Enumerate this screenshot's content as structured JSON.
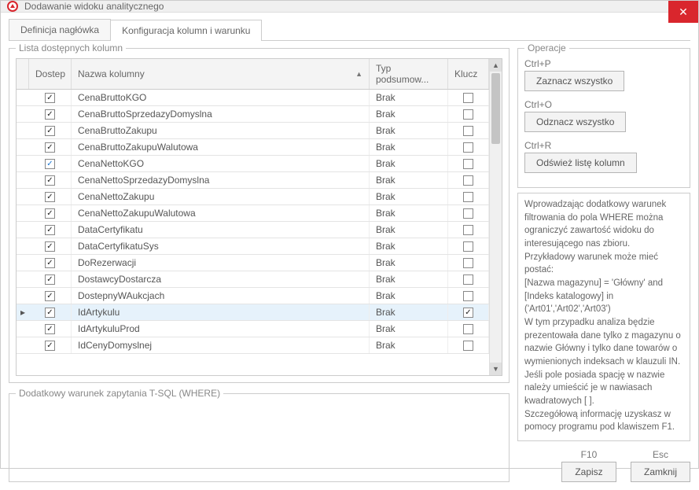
{
  "window": {
    "title": "Dodawanie widoku analitycznego"
  },
  "tabs": {
    "def": "Definicja nagłówka",
    "cfg": "Konfiguracja kolumn  i warunku"
  },
  "columns_fs": {
    "legend": "Lista dostępnych kolumn"
  },
  "headers": {
    "dostep": "Dostep",
    "nazwa": "Nazwa kolumny",
    "typ": "Typ podsumow...",
    "klucz": "Klucz"
  },
  "rows": [
    {
      "dostep": true,
      "blue": false,
      "nazwa": "CenaBruttoKGO",
      "typ": "Brak",
      "klucz": false,
      "sel": false
    },
    {
      "dostep": true,
      "blue": false,
      "nazwa": "CenaBruttoSprzedazyDomyslna",
      "typ": "Brak",
      "klucz": false,
      "sel": false
    },
    {
      "dostep": true,
      "blue": false,
      "nazwa": "CenaBruttoZakupu",
      "typ": "Brak",
      "klucz": false,
      "sel": false
    },
    {
      "dostep": true,
      "blue": false,
      "nazwa": "CenaBruttoZakupuWalutowa",
      "typ": "Brak",
      "klucz": false,
      "sel": false
    },
    {
      "dostep": true,
      "blue": true,
      "nazwa": "CenaNettoKGO",
      "typ": "Brak",
      "klucz": false,
      "sel": false
    },
    {
      "dostep": true,
      "blue": false,
      "nazwa": "CenaNettoSprzedazyDomyslna",
      "typ": "Brak",
      "klucz": false,
      "sel": false
    },
    {
      "dostep": true,
      "blue": false,
      "nazwa": "CenaNettoZakupu",
      "typ": "Brak",
      "klucz": false,
      "sel": false
    },
    {
      "dostep": true,
      "blue": false,
      "nazwa": "CenaNettoZakupuWalutowa",
      "typ": "Brak",
      "klucz": false,
      "sel": false
    },
    {
      "dostep": true,
      "blue": false,
      "nazwa": "DataCertyfikatu",
      "typ": "Brak",
      "klucz": false,
      "sel": false
    },
    {
      "dostep": true,
      "blue": false,
      "nazwa": "DataCertyfikatuSys",
      "typ": "Brak",
      "klucz": false,
      "sel": false
    },
    {
      "dostep": true,
      "blue": false,
      "nazwa": "DoRezerwacji",
      "typ": "Brak",
      "klucz": false,
      "sel": false
    },
    {
      "dostep": true,
      "blue": false,
      "nazwa": "DostawcyDostarcza",
      "typ": "Brak",
      "klucz": false,
      "sel": false
    },
    {
      "dostep": true,
      "blue": false,
      "nazwa": "DostepnyWAukcjach",
      "typ": "Brak",
      "klucz": false,
      "sel": false
    },
    {
      "dostep": true,
      "blue": false,
      "nazwa": "IdArtykulu",
      "typ": "Brak",
      "klucz": true,
      "sel": true
    },
    {
      "dostep": true,
      "blue": false,
      "nazwa": "IdArtykuluProd",
      "typ": "Brak",
      "klucz": false,
      "sel": false
    },
    {
      "dostep": true,
      "blue": false,
      "nazwa": "IdCenyDomyslnej",
      "typ": "Brak",
      "klucz": false,
      "sel": false
    }
  ],
  "extra_fs": {
    "legend": "Dodatkowy warunek zapytania T-SQL (WHERE)"
  },
  "ops_fs": {
    "legend": "Operacje"
  },
  "ops": {
    "select_all": {
      "shortcut": "Ctrl+P",
      "label": "Zaznacz wszystko"
    },
    "deselect_all": {
      "shortcut": "Ctrl+O",
      "label": "Odznacz wszystko"
    },
    "refresh": {
      "shortcut": "Ctrl+R",
      "label": "Odśwież listę kolumn"
    }
  },
  "info": "Wprowadzając dodatkowy warunek filtrowania do pola WHERE można ograniczyć zawartość widoku do interesującego nas zbioru.\nPrzykładowy warunek może mieć postać:\n[Nazwa magazynu] = 'Główny' and [Indeks katalogowy] in ('Art01','Art02','Art03')\nW tym przypadku analiza będzie prezentowała dane tylko z magazynu o nazwie Główny i tylko dane towarów o wymienionych indeksach w klauzuli IN.\nJeśli pole posiada spację w nazwie należy umieścić je w nawiasach kwadratowych [ ].\nSzczegółową informację uzyskasz w pomocy programu pod klawiszem F1.",
  "footer": {
    "save": {
      "shortcut": "F10",
      "label": "Zapisz"
    },
    "close": {
      "shortcut": "Esc",
      "label": "Zamknij"
    }
  }
}
